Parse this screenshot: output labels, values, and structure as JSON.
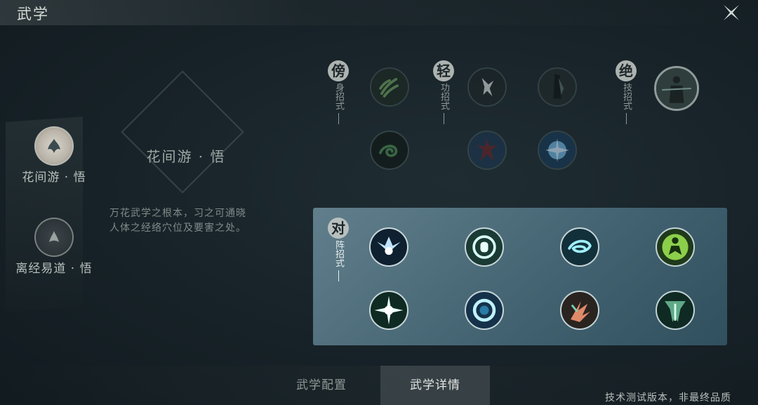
{
  "header": {
    "title": "武学"
  },
  "left_list": [
    {
      "label": "花间游 · 悟",
      "selected": true
    },
    {
      "label": "离经易道 · 悟",
      "selected": false
    }
  ],
  "detail": {
    "name": "花间游 · 悟",
    "desc_line1": "万花武学之根本，习之可通晓",
    "desc_line2": "人体之经络穴位及要害之处。"
  },
  "groups": {
    "shen": {
      "big": "傍",
      "small": "身招式",
      "icons": [
        "vine-claw-skill-icon",
        "spiral-dark-skill-icon"
      ]
    },
    "qing": {
      "big": "轻",
      "small": "功招式",
      "icons": [
        "leaping-figure-skill-icon",
        "dark-blade-skill-icon",
        "red-dancer-skill-icon",
        "blue-burst-skill-icon"
      ]
    },
    "jue": {
      "big": "绝",
      "small": "技招式",
      "icons": [
        "standing-master-skill-icon"
      ]
    },
    "dui": {
      "big": "对",
      "small": "阵招式",
      "icons": [
        "spread-wings-skill-icon",
        "shield-ring-skill-icon",
        "whirlwind-skill-icon",
        "meditation-skill-icon",
        "starburst-skill-icon",
        "vortex-skill-icon",
        "flame-strike-skill-icon",
        "cascade-skill-icon"
      ]
    }
  },
  "tabs": {
    "config": "武学配置",
    "details": "武学详情"
  },
  "watermark": "技术测试版本，非最终品质",
  "colors": {
    "panel": "#6f98a8",
    "accent": "#cfd6d4"
  }
}
